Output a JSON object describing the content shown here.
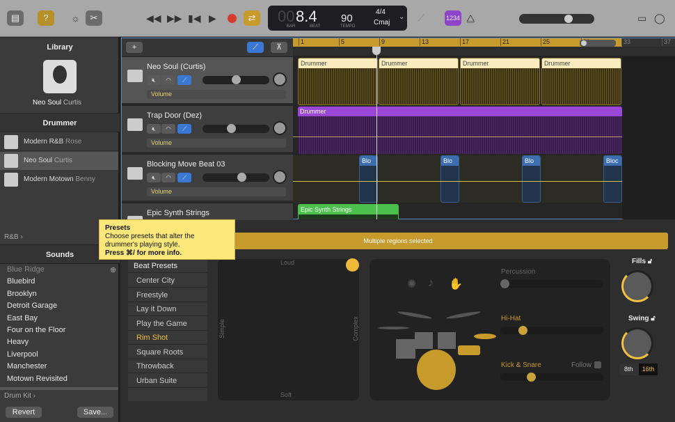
{
  "toolbar": {
    "lcd": {
      "bar_dim": "00",
      "position": "8.4",
      "bar_label": "BAR",
      "beat_label": "BEAT",
      "tempo": "90",
      "tempo_label": "TEMPO",
      "time_sig": "4/4",
      "key": "Cmaj"
    },
    "count_in": "1234",
    "colors": {
      "accent_yellow": "#c69a2b",
      "count_in_purple": "#8e44c9"
    }
  },
  "library": {
    "title": "Library",
    "drummer_name": "Neo Soul",
    "drummer_person": "Curtis",
    "drummer_header": "Drummer",
    "drummers": [
      {
        "style": "Modern R&B",
        "name": "Rose"
      },
      {
        "style": "Neo Soul",
        "name": "Curtis",
        "selected": true
      },
      {
        "style": "Modern Motown",
        "name": "Benny"
      }
    ],
    "genre": "R&B ›",
    "sounds_header": "Sounds",
    "sounds": [
      "Blue Ridge",
      "Bluebird",
      "Brooklyn",
      "Detroit Garage",
      "East Bay",
      "Four on the Floor",
      "Heavy",
      "Liverpool",
      "Manchester",
      "Motown Revisited"
    ],
    "kit_label": "Drum Kit ›",
    "revert": "Revert",
    "save": "Save..."
  },
  "tracks": {
    "add": "+",
    "ruler": [
      "1",
      "5",
      "9",
      "13",
      "17",
      "21",
      "25",
      "29",
      "33",
      "37"
    ],
    "list": [
      {
        "name": "Neo Soul (Curtis)",
        "automation": "Volume",
        "fader": 0.5,
        "selected": true
      },
      {
        "name": "Trap Door (Dez)",
        "automation": "Volume",
        "fader": 0.42
      },
      {
        "name": "Blocking Move Beat 03",
        "automation": "Volume",
        "fader": 0.6
      },
      {
        "name": "Epic Synth Strings"
      }
    ],
    "regions": {
      "drummer": "Drummer",
      "blocking": "Blo",
      "blocking_last": "Bloc",
      "synth": "Epic Synth   Strings"
    }
  },
  "tooltip": {
    "title": "Presets",
    "body": "Choose presets that alter the drummer's playing style.",
    "hint": "Press ⌘/ for more info."
  },
  "editor": {
    "banner": "Multiple regions selected",
    "presets_header": "Beat Presets",
    "presets": [
      "Center City",
      "Freestyle",
      "Lay it Down",
      "Play the Game",
      "Rim Shot",
      "Square Roots",
      "Throwback",
      "Urban Suite"
    ],
    "selected_preset": "Rim Shot",
    "pad": {
      "top": "Loud",
      "bottom": "Soft",
      "left": "Simple",
      "right": "Complex"
    },
    "percussion": "Percussion",
    "hihat": "Hi-Hat",
    "kick_snare": "Kick & Snare",
    "follow": "Follow",
    "percussion_value": 0,
    "hihat_value": 0.22,
    "kick_value": 0.3,
    "fills": "Fills",
    "swing": "Swing",
    "eighth": "8th",
    "sixteenth": "16th"
  }
}
